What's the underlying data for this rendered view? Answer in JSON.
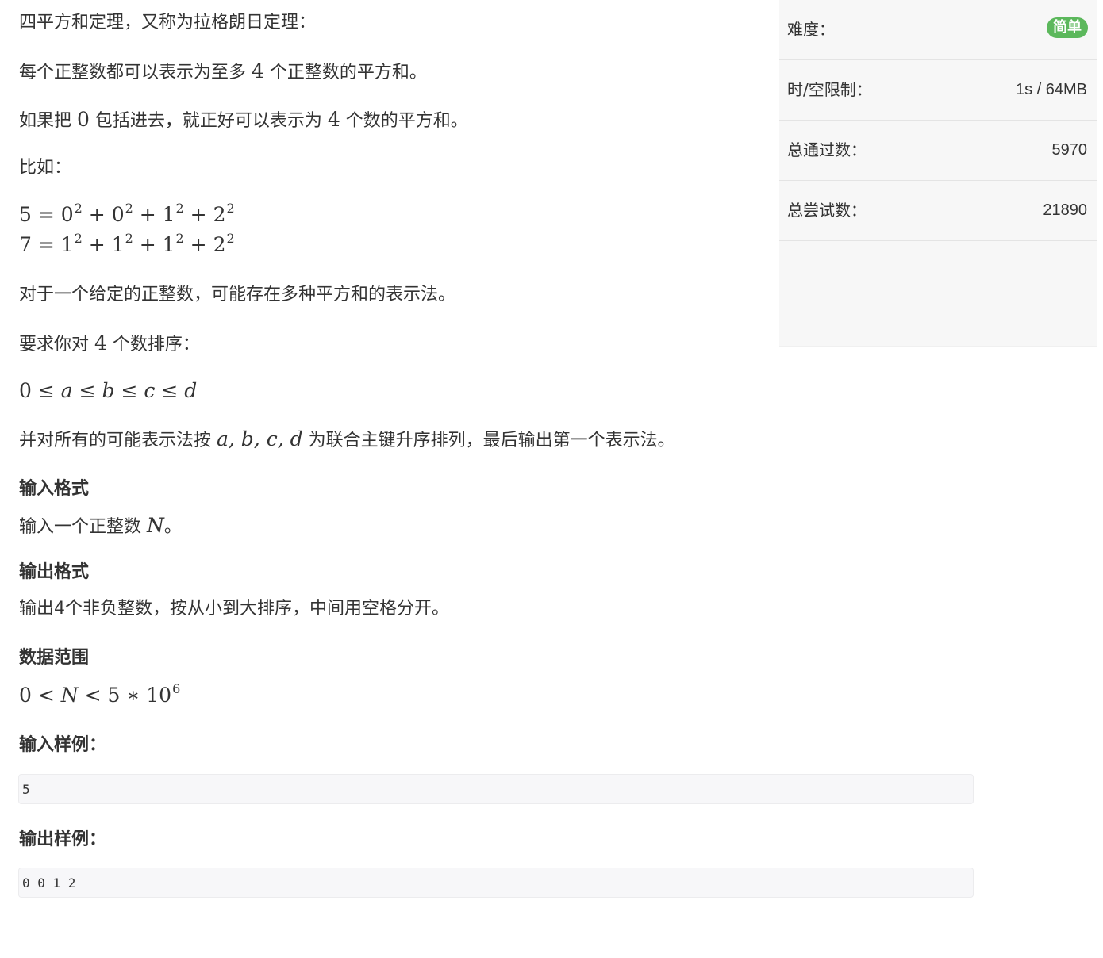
{
  "problem": {
    "intro": "四平方和定理，又称为拉格朗日定理：",
    "statement": {
      "pre": "每个正整数都可以表示为至多 ",
      "num": "4",
      "post": " 个正整数的平方和。"
    },
    "zero_note": {
      "pre": "如果把 ",
      "zero": "0",
      "mid": " 包括进去，就正好可以表示为 ",
      "four": "4",
      "post": " 个数的平方和。"
    },
    "example_label": "比如：",
    "example_eqs": [
      {
        "lhs": "5 = ",
        "terms": [
          [
            "0",
            "2"
          ],
          [
            "0",
            "2"
          ],
          [
            "1",
            "2"
          ],
          [
            "2",
            "2"
          ]
        ]
      },
      {
        "lhs": "7 = ",
        "terms": [
          [
            "1",
            "2"
          ],
          [
            "1",
            "2"
          ],
          [
            "1",
            "2"
          ],
          [
            "2",
            "2"
          ]
        ]
      }
    ],
    "multi_note": "对于一个给定的正整数，可能存在多种平方和的表示法。",
    "sort_req": {
      "pre": "要求你对 ",
      "num": "4",
      "post": " 个数排序："
    },
    "order_expr": [
      "0",
      "≤",
      "a",
      "≤",
      "b",
      "≤",
      "c",
      "≤",
      "d"
    ],
    "key_note": {
      "pre": "并对所有的可能表示法按 ",
      "vars": "a, b, c, d",
      "post": " 为联合主键升序排列，最后输出第一个表示法。"
    },
    "input_heading": "输入格式",
    "input_desc": {
      "pre": "输入一个正整数 ",
      "var": "N",
      "post": "。"
    },
    "output_heading": "输出格式",
    "output_desc": "输出4个非负整数，按从小到大排序，中间用空格分开。",
    "range_heading": "数据范围",
    "range_expr": {
      "a": "0 < ",
      "n": "N",
      "b": " < 5 ∗ 10",
      "exp": "6"
    },
    "sample_input_heading": "输入样例：",
    "sample_input": "5",
    "sample_output_heading": "输出样例：",
    "sample_output": "0 0 1 2"
  },
  "sidebar": {
    "difficulty_label": "难度：",
    "difficulty_value": "简单",
    "difficulty_color": "#5cb85c",
    "limit_label": "时/空限制：",
    "limit_value": "1s / 64MB",
    "accepted_label": "总通过数：",
    "accepted_value": "5970",
    "attempts_label": "总尝试数：",
    "attempts_value": "21890"
  }
}
